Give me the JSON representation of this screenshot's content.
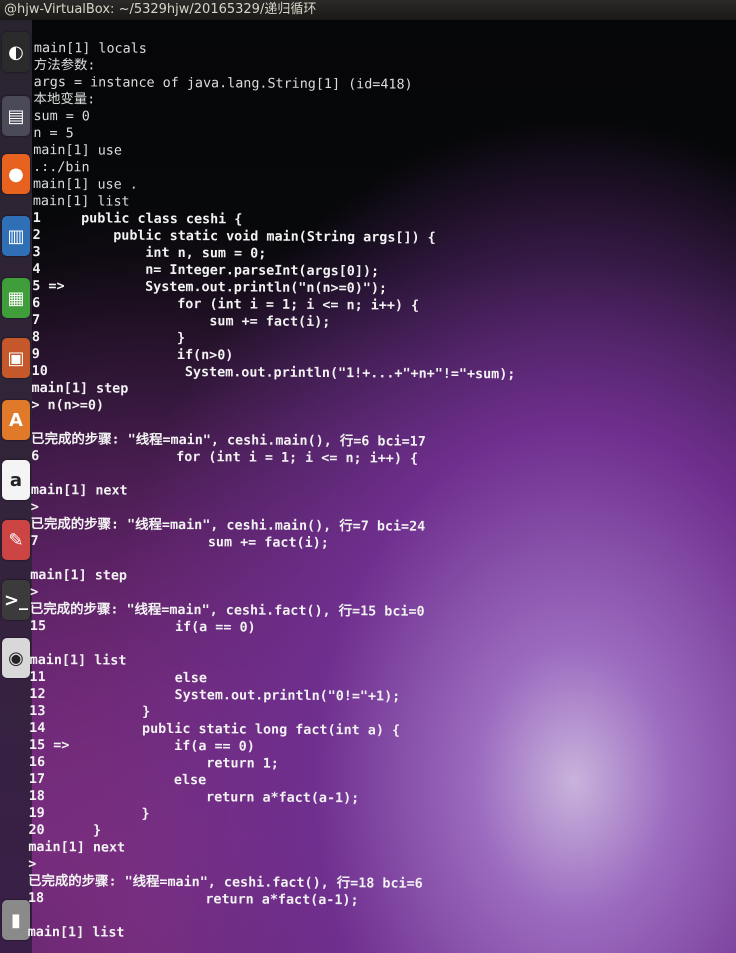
{
  "window": {
    "title": "@hjw-VirtualBox: ~/5329hjw/20165329/递归循环"
  },
  "launcher": {
    "items": [
      {
        "icon": "ubuntu-dash-icon",
        "glyph": "◐",
        "color": "#2b2b2b"
      },
      {
        "icon": "files-icon",
        "glyph": "▤",
        "color": "#4a4a58"
      },
      {
        "icon": "firefox-icon",
        "glyph": "●",
        "color": "#e8621f"
      },
      {
        "icon": "writer-icon",
        "glyph": "▥",
        "color": "#2f6fb5"
      },
      {
        "icon": "calc-icon",
        "glyph": "▦",
        "color": "#3f9e3a"
      },
      {
        "icon": "impress-icon",
        "glyph": "▣",
        "color": "#c4582a"
      },
      {
        "icon": "software-center-icon",
        "glyph": "A",
        "color": "#e07a2a"
      },
      {
        "icon": "amazon-icon",
        "glyph": "a",
        "color": "#f4f4f4"
      },
      {
        "icon": "settings-icon",
        "glyph": "✎",
        "color": "#c44"
      },
      {
        "icon": "terminal-icon",
        "glyph": ">_",
        "color": "#3b3b3b"
      },
      {
        "icon": "dvd-icon",
        "glyph": "◉",
        "color": "#d8d8d8"
      },
      {
        "icon": "trash-icon",
        "glyph": "▮",
        "color": "#8a8a8a"
      }
    ]
  },
  "terminal": {
    "lines": [
      {
        "text": "main[1] locals",
        "style": "top"
      },
      {
        "text": "方法参数:",
        "style": "top"
      },
      {
        "text": "args = instance of java.lang.String[1] (id=418)",
        "style": "top"
      },
      {
        "text": "本地变量:",
        "style": "top"
      },
      {
        "text": "sum = 0",
        "style": "top"
      },
      {
        "text": "n = 5",
        "style": "top"
      },
      {
        "text": "main[1] use",
        "style": "top"
      },
      {
        "text": ".:./bin",
        "style": "top"
      },
      {
        "text": "main[1] use .",
        "style": "top"
      },
      {
        "text": "main[1] list",
        "style": "top"
      },
      {
        "text": "1     public class ceshi {",
        "style": "bold"
      },
      {
        "text": "2         public static void main(String args[]) {",
        "style": "bold"
      },
      {
        "text": "3             int n, sum = 0;",
        "style": "bold"
      },
      {
        "text": "4             n= Integer.parseInt(args[0]);",
        "style": "bold"
      },
      {
        "text": "5 =>          System.out.println(\"n(n>=0)\");",
        "style": "bold"
      },
      {
        "text": "6                 for (int i = 1; i <= n; i++) {",
        "style": "bold"
      },
      {
        "text": "7                     sum += fact(i);",
        "style": "bold"
      },
      {
        "text": "8                 }",
        "style": "bold"
      },
      {
        "text": "9                 if(n>0)",
        "style": "bold"
      },
      {
        "text": "10                 System.out.println(\"1!+...+\"+n+\"!=\"+sum);",
        "style": "bold"
      },
      {
        "text": "main[1] step",
        "style": "bold"
      },
      {
        "text": "> n(n>=0)",
        "style": "bold"
      },
      {
        "text": "",
        "style": "bold"
      },
      {
        "text": "已完成的步骤: \"线程=main\", ceshi.main(), 行=6 bci=17",
        "style": "bold"
      },
      {
        "text": "6                 for (int i = 1; i <= n; i++) {",
        "style": "bold"
      },
      {
        "text": "",
        "style": "bold"
      },
      {
        "text": "main[1] next",
        "style": "bold"
      },
      {
        "text": ">",
        "style": "bold"
      },
      {
        "text": "已完成的步骤: \"线程=main\", ceshi.main(), 行=7 bci=24",
        "style": "bold"
      },
      {
        "text": "7                     sum += fact(i);",
        "style": "bold"
      },
      {
        "text": "",
        "style": "bold"
      },
      {
        "text": "main[1] step",
        "style": "bold"
      },
      {
        "text": ">",
        "style": "bold"
      },
      {
        "text": "已完成的步骤: \"线程=main\", ceshi.fact(), 行=15 bci=0",
        "style": "bold"
      },
      {
        "text": "15                if(a == 0)",
        "style": "bold"
      },
      {
        "text": "",
        "style": "bold"
      },
      {
        "text": "main[1] list",
        "style": "bold"
      },
      {
        "text": "11                else",
        "style": "bold"
      },
      {
        "text": "12                System.out.println(\"0!=\"+1);",
        "style": "bold"
      },
      {
        "text": "13            }",
        "style": "bold"
      },
      {
        "text": "14            public static long fact(int a) {",
        "style": "bold"
      },
      {
        "text": "15 =>             if(a == 0)",
        "style": "bold"
      },
      {
        "text": "16                    return 1;",
        "style": "bold"
      },
      {
        "text": "17                else",
        "style": "bold"
      },
      {
        "text": "18                    return a*fact(a-1);",
        "style": "bold"
      },
      {
        "text": "19            }",
        "style": "bold"
      },
      {
        "text": "20      }",
        "style": "bold"
      },
      {
        "text": "main[1] next",
        "style": "bold"
      },
      {
        "text": ">",
        "style": "bold"
      },
      {
        "text": "已完成的步骤: \"线程=main\", ceshi.fact(), 行=18 bci=6",
        "style": "bold"
      },
      {
        "text": "18                    return a*fact(a-1);",
        "style": "bold"
      },
      {
        "text": "",
        "style": "bold"
      },
      {
        "text": "main[1] list",
        "style": "bold"
      }
    ]
  }
}
